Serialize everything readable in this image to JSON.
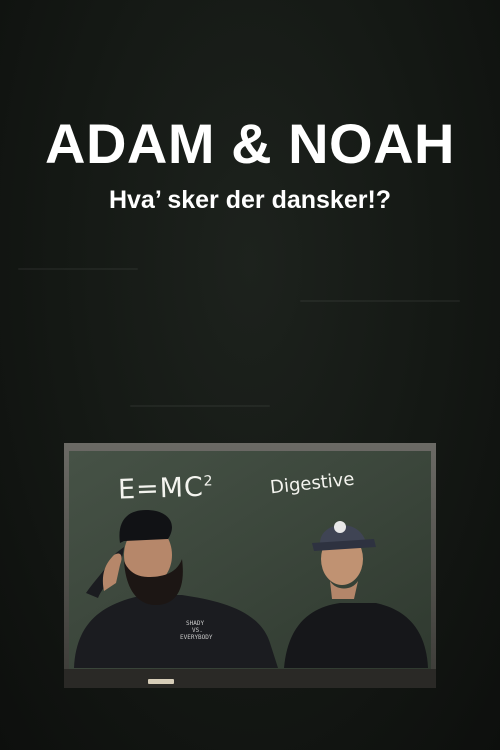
{
  "poster": {
    "title": "ADAM & NOAH",
    "subtitle": "Hva’ sker der dansker!?",
    "chalkboard": {
      "formula_base": "E=MC",
      "formula_exponent": "2",
      "word": "Digestive",
      "left_hoodie_print": "SHADY\nVS.\nEVERYBODY"
    },
    "colors": {
      "background": "#141814",
      "chalkboard": "#3e4a3e",
      "text": "#ffffff"
    }
  }
}
